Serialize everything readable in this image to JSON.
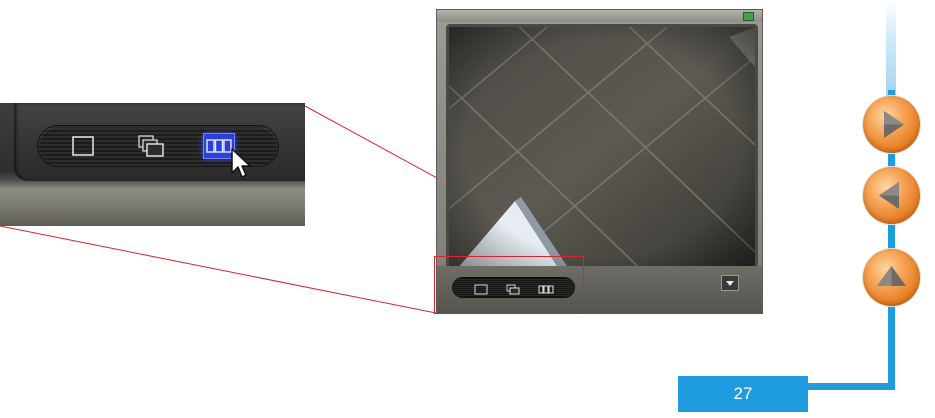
{
  "page_number": "27",
  "icons": {
    "single_view": "single-view-icon",
    "cascade_view": "cascade-view-icon",
    "tile_view": "tile-view-icon",
    "next": "arrow-right-icon",
    "previous": "arrow-left-icon",
    "up": "arrow-up-icon",
    "dropdown": "chevron-down-icon",
    "cursor": "mouse-cursor-icon",
    "status": "status-led-icon"
  },
  "colors": {
    "highlight": "#d8242a",
    "active_button": "#2c3fd8",
    "nav_accent": "#1f9be0",
    "nav_button": "#e47b22"
  }
}
